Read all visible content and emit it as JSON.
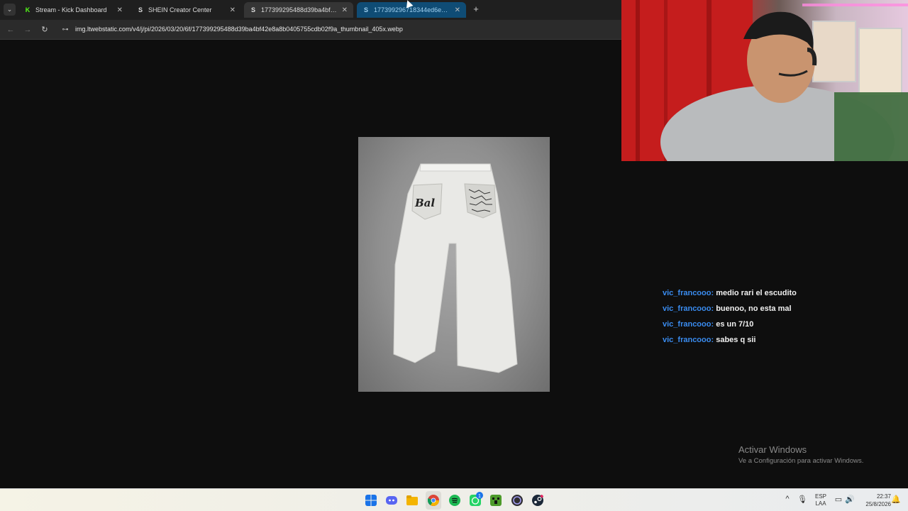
{
  "browser": {
    "tabs": [
      {
        "favicon": "K",
        "title": "Stream - Kick Dashboard",
        "close": "✕"
      },
      {
        "favicon": "S",
        "title": "SHEIN Creator Center",
        "close": "✕"
      },
      {
        "favicon": "S",
        "title": "177399295488d39ba4bf42e8a",
        "close": "✕"
      },
      {
        "favicon": "S",
        "title": "177399296718344ed6e58f9fc8",
        "close": "✕"
      }
    ],
    "new_tab": "+",
    "tab_search": "⌄",
    "nav": {
      "back": "←",
      "forward": "→",
      "reload": "↻",
      "site_info": "⊶"
    },
    "url": "img.ltwebstatic.com/v4/j/pi/2026/03/20/6f/177399295488d39ba4bf42e8a8b0405755cdb02f9a_thumbnail_405x.webp"
  },
  "chat": [
    {
      "user": "vic_francooo:",
      "text": "medio rari el escudito"
    },
    {
      "user": "vic_francooo:",
      "text": "buenoo, no esta mal"
    },
    {
      "user": "vic_francooo:",
      "text": "es un 7/10"
    },
    {
      "user": "vic_francooo:",
      "text": "sabes q sii"
    }
  ],
  "product": {
    "pocket_text": "Bal"
  },
  "activation": {
    "title": "Activar Windows",
    "subtitle": "Ve a Configuración para activar Windows."
  },
  "taskbar": {
    "icons": [
      "windows-start-icon",
      "discord-icon",
      "file-explorer-icon",
      "chrome-icon",
      "spotify-icon",
      "whatsapp-icon",
      "minecraft-icon",
      "obs-icon",
      "steam-icon"
    ],
    "whatsapp_badge": "1",
    "tray": {
      "chevron": "^",
      "lang_top": "ESP",
      "lang_bottom": "LAA",
      "time": "22:37",
      "date": "25/8/2026"
    }
  },
  "colors": {
    "chat_user": "#3a8cf0",
    "active_tab": "#0f4c75",
    "kick_green": "#53fc18"
  }
}
